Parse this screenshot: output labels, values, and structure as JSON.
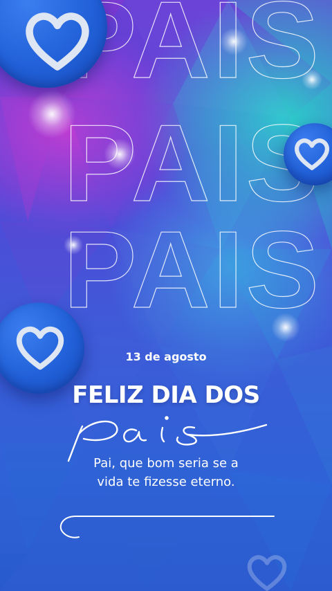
{
  "poster": {
    "background_word": "PAIS",
    "date": "13 de agosto",
    "headline": "FELIZ DIA DOS",
    "script_word": "pais",
    "quote_line_1": "Pai, que bom seria se a",
    "quote_line_2": "vida te fizesse eterno."
  },
  "icons": {
    "badge_icon": "heart-outline-icon",
    "decoration": "swoosh-line"
  },
  "colors": {
    "badge_blue": "#2160d8",
    "heart_outline": "#dfe6f3",
    "text": "#ffffff",
    "gradient_top": "#6b3fd6",
    "gradient_bottom": "#2b5bcf",
    "accent_teal": "#28dcc8",
    "accent_magenta": "#c83cd2"
  }
}
